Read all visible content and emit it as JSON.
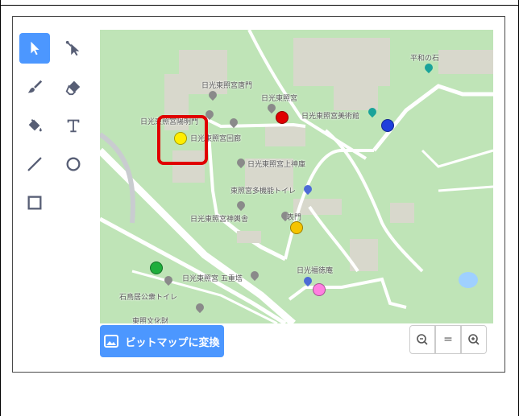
{
  "toolbar": {
    "tools": [
      {
        "id": "select",
        "icon": "arrow-icon",
        "active": true
      },
      {
        "id": "reshape",
        "icon": "reshape-icon",
        "active": false
      },
      {
        "id": "brush",
        "icon": "brush-icon",
        "active": false
      },
      {
        "id": "eraser",
        "icon": "eraser-icon",
        "active": false
      },
      {
        "id": "fill",
        "icon": "fill-bucket-icon",
        "active": false
      },
      {
        "id": "text",
        "icon": "text-icon",
        "active": false
      },
      {
        "id": "line",
        "icon": "line-icon",
        "active": false
      },
      {
        "id": "circle",
        "icon": "circle-icon",
        "active": false
      },
      {
        "id": "rect",
        "icon": "rectangle-icon",
        "active": false
      }
    ]
  },
  "map": {
    "labels": {
      "gate": "日光東照宮唐門",
      "honden": "日光東照宮",
      "left_cut": "日光東照宮陽明門",
      "museum": "日光東照宮美術館",
      "kairou": "日光東照宮回廊",
      "kamijinko": "日光東照宮上神庫",
      "toilet": "東照宮多機能トイレ",
      "shinyo": "日光東照宮神輿舎",
      "omote": "表門",
      "gojunoto": "日光東照宮 五重塔",
      "fukutoku": "日光福徳庵",
      "toilet2": "石鳥居公衆トイレ",
      "heiwa": "平和の石",
      "bunka": "東照文化財"
    },
    "markers": {
      "red": "#e00000",
      "blue": "#1f3fdc",
      "yellow_main": "#ffee00",
      "yellow_gate": "#f5c400",
      "green": "#1fae3c",
      "pink": "#ff7fe0"
    }
  },
  "convert_button": {
    "label": "ビットマップに変換",
    "icon": "image-icon"
  },
  "zoom": {
    "out": "zoom-out-icon",
    "reset": "=",
    "in": "zoom-in-icon"
  }
}
